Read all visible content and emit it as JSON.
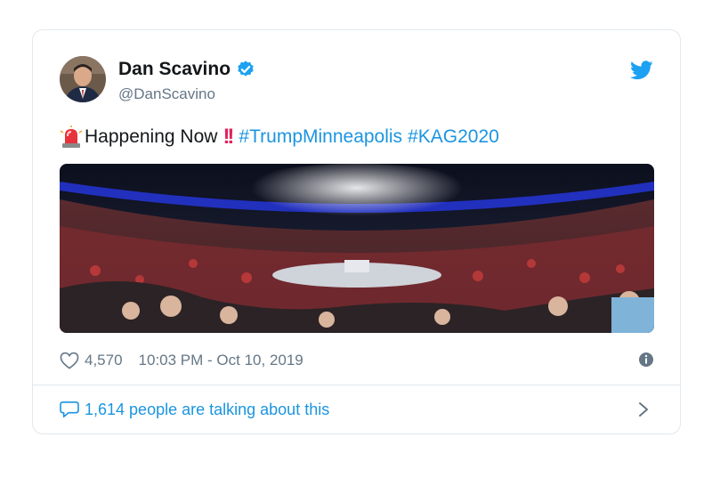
{
  "author": {
    "display_name": "Dan Scavino",
    "handle": "@DanScavino",
    "verified_icon": "verified-badge-icon"
  },
  "tweet": {
    "lead_emoji": "siren-icon",
    "text": "Happening Now",
    "emphasis_emoji": "double-exclamation-icon",
    "hashtags": [
      "#TrumpMinneapolis",
      "#KAG2020"
    ]
  },
  "footer": {
    "like_count": "4,570",
    "timestamp": "10:03 PM - Oct 10, 2019"
  },
  "conversation": {
    "label": "1,614 people are talking about this"
  },
  "colors": {
    "link": "#1b95e0",
    "secondary_text": "#657786",
    "border": "#e1e8ed",
    "emphasis": "#e0245e"
  }
}
